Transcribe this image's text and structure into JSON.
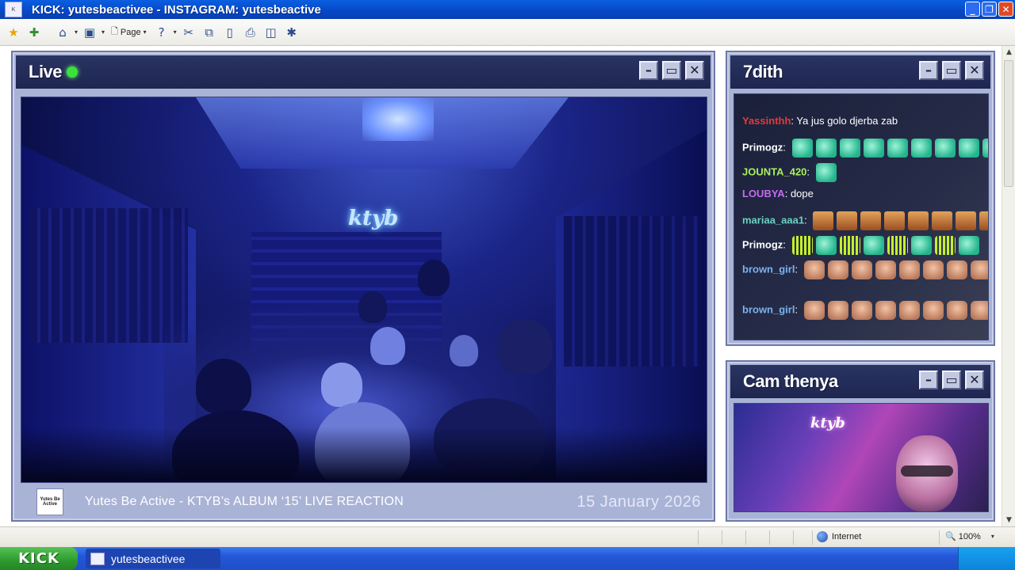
{
  "window": {
    "title": "KICK: yutesbeactivee  -  INSTAGRAM: yutesbeactive",
    "app_icon": "kick-logo-icon",
    "buttons": [
      "minimize",
      "restore",
      "close"
    ]
  },
  "toolbar": {
    "page_label": "Page",
    "icons": [
      "favorites-star-icon",
      "add-favorite-icon",
      "home-icon",
      "feeds-icon",
      "page-icon",
      "help-icon",
      "research-icon",
      "copy-icon",
      "clipboard-icon",
      "print-icon",
      "fullscreen-icon",
      "bluetooth-icon"
    ]
  },
  "main_panel": {
    "title": "Live",
    "live_indicator_color": "#39e23b",
    "stream_title": "Yutes Be Active - KTYB’s ALBUM ‘15’ LIVE REACTION",
    "date": "15 January 2026",
    "logo_text": "Yutes Be Active",
    "neon_sign": "ktyb"
  },
  "chat_panel": {
    "title": "7dith",
    "messages": [
      {
        "user": "Yassinthh",
        "color": "#e33b3b",
        "text": "Ya jus golo djerba zab",
        "emotes": []
      },
      {
        "user": "Primogz",
        "color": "#ffffff",
        "text": "",
        "emotes": [
          "dance",
          "dance",
          "dance",
          "dance",
          "dance",
          "dance",
          "dance",
          "dance",
          "dance"
        ]
      },
      {
        "user": "JOUNTA_420",
        "color": "#a8f05a",
        "text": "",
        "emotes": [
          "dance"
        ]
      },
      {
        "user": "LOUBYA",
        "color": "#c56cf0",
        "text": "dope",
        "emotes": []
      },
      {
        "user": "mariaa_aaa1",
        "color": "#6ad2c3",
        "text": "",
        "emotes": [
          "face",
          "face",
          "face",
          "face",
          "face",
          "face",
          "face",
          "face"
        ]
      },
      {
        "user": "Primogz",
        "color": "#ffffff",
        "text": "",
        "emotes": [
          "bar",
          "dance",
          "bar",
          "dance",
          "bar",
          "dance",
          "bar",
          "dance"
        ]
      },
      {
        "user": "brown_girl",
        "color": "#7bb2f0",
        "text": "",
        "emotes": [
          "hand",
          "hand",
          "hand",
          "hand",
          "hand",
          "hand",
          "hand",
          "hand"
        ]
      },
      {
        "user": "brown_girl",
        "color": "#7bb2f0",
        "text": "",
        "emotes": [
          "hand",
          "hand",
          "hand",
          "hand",
          "hand",
          "hand",
          "hand",
          "hand"
        ]
      }
    ]
  },
  "cam_panel": {
    "title": "Cam thenya",
    "neon_sign": "ktyb"
  },
  "statusbar": {
    "zone": "Internet",
    "zoom": "100%"
  },
  "taskbar": {
    "start_label": "KICK",
    "task_label": "yutesbeactivee"
  },
  "colors": {
    "panel_bg": "#a9b3d6",
    "panel_head": "#1e2650",
    "taskbar": "#2456d8",
    "start": "#2d9a2d"
  }
}
